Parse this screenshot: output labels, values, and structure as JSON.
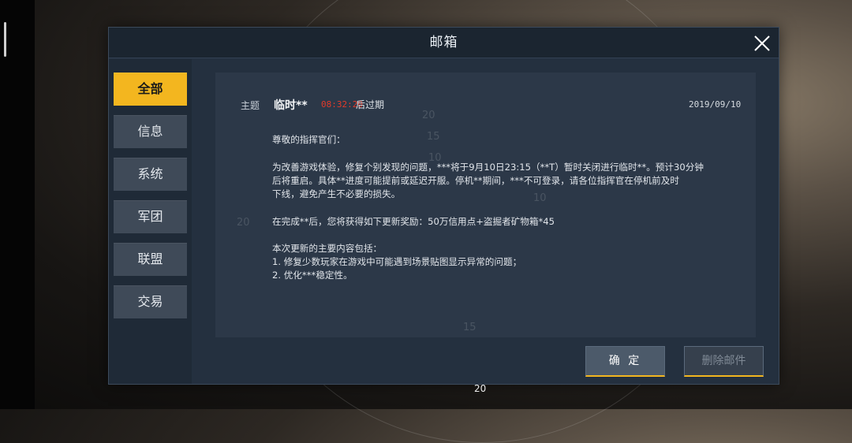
{
  "dialog": {
    "title": "邮箱"
  },
  "tabs": [
    {
      "label": "全部",
      "active": true
    },
    {
      "label": "信息",
      "active": false
    },
    {
      "label": "系统",
      "active": false
    },
    {
      "label": "军团",
      "active": false
    },
    {
      "label": "联盟",
      "active": false
    },
    {
      "label": "交易",
      "active": false
    }
  ],
  "mail": {
    "subject_label": "主题",
    "subject": "临时**",
    "expire_time": "08:32:20",
    "expire_suffix": "后过期",
    "date": "2019/09/10",
    "body": [
      "尊敬的指挥官们：",
      "为改善游戏体验，修复个别发现的问题，***将于9月10日23:15（**T）暂时关闭进行临时**。预计30分钟",
      "后将重启。具体**进度可能提前或延迟开服。停机**期间，***不可登录，请各位指挥官在停机前及时",
      "下线，避免产生不必要的损失。",
      "在完成**后，您将获得如下更新奖励：50万信用点+盗掘者矿物箱*45",
      "本次更新的主要内容包括：",
      "1. 修复少数玩家在游戏中可能遇到场景贴图显示异常的问题；",
      "2. 优化***稳定性。"
    ]
  },
  "buttons": {
    "confirm": "确 定",
    "delete": "删除邮件"
  },
  "background_numbers": [
    "20",
    "15",
    "10",
    "20",
    "10",
    "15",
    "20"
  ],
  "colors": {
    "accent": "#f3b61f",
    "expire": "#e23a2a",
    "panel": "#24303f"
  }
}
